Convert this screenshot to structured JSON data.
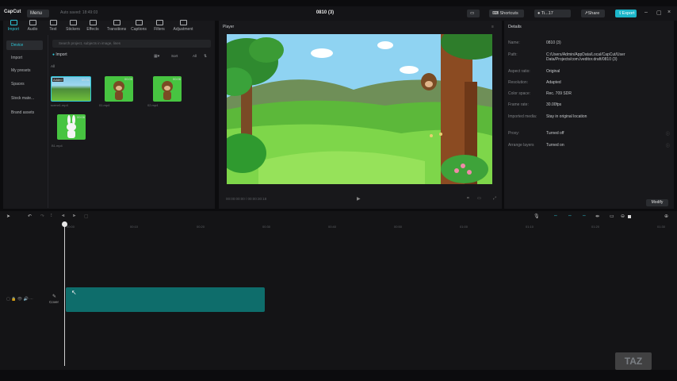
{
  "app": {
    "logo": "CapCut",
    "menu_label": "Menu",
    "autosave": "Auto saved: 18:49:03",
    "project_title": "0810 (3)",
    "shortcuts_label": "Shortcuts",
    "user_label": "Ti...17",
    "share_label": "Share",
    "export_label": "Export"
  },
  "tools": [
    "Import",
    "Audio",
    "Text",
    "Stickers",
    "Effects",
    "Transitions",
    "Captions",
    "Filters",
    "Adjustment"
  ],
  "side_nav": [
    "Device",
    "Import",
    "My presets",
    "Spaces",
    "Stock mate...",
    "Brand assets"
  ],
  "media": {
    "search_placeholder": "Search project, subjects in image, lines",
    "import_label": "Import",
    "sort_label": "Sort",
    "all_label": "All",
    "filter_all": "All",
    "items": [
      {
        "name": "scene1.mp4",
        "duration": "00:31",
        "badge": "Added"
      },
      {
        "name": "01.mp4",
        "duration": "00:05"
      },
      {
        "name": "02.mp4",
        "duration": "00:06"
      },
      {
        "name": "B1.mp4",
        "duration": "00:06"
      }
    ]
  },
  "player": {
    "title": "Player",
    "timecode": "00:00:00:00  /  00:00:30:18"
  },
  "details": {
    "title": "Details",
    "rows": [
      {
        "key": "Name:",
        "value": "0810 (3)"
      },
      {
        "key": "Path:",
        "value": "C:/Users/Admin/AppData/Local/CapCut/User Data/Projects/com.lveditor.draft/0810 (3)"
      },
      {
        "key": "Aspect ratio:",
        "value": "Original"
      },
      {
        "key": "Resolution:",
        "value": "Adapted"
      },
      {
        "key": "Color space:",
        "value": "Rec. 709 SDR"
      },
      {
        "key": "Frame rate:",
        "value": "30.00fps"
      },
      {
        "key": "Imported media:",
        "value": "Stay in original location"
      },
      {
        "key": "Proxy:",
        "value": "Turned off"
      },
      {
        "key": "Arrange layers",
        "value": "Turned on"
      }
    ],
    "modify_label": "Modify"
  },
  "timeline": {
    "ticks": [
      "00:00",
      "00:10",
      "00:20",
      "00:30",
      "00:40",
      "00:50",
      "01:00",
      "01:10",
      "01:20",
      "01:30"
    ],
    "cover_label": "Cover"
  },
  "watermark": "TAZ",
  "colors": {
    "accent": "#1bb5c9",
    "clip": "#0e6d6b"
  }
}
